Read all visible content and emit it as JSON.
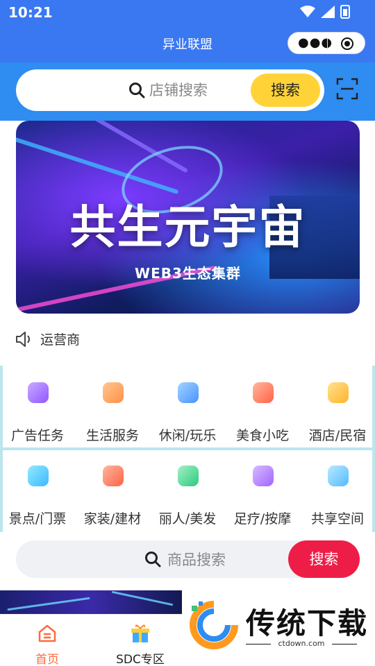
{
  "status_bar": {
    "time": "10:21"
  },
  "app": {
    "title": "异业联盟"
  },
  "store_search": {
    "placeholder": "店铺搜索",
    "button": "搜索"
  },
  "banner": {
    "title": "共生元宇宙",
    "subtitle": "WEB3生态集群"
  },
  "notice": {
    "text": "运营商"
  },
  "categories_row1": [
    {
      "label": "广告任务",
      "icon": "bell-icon"
    },
    {
      "label": "生活服务",
      "icon": "phone-charge-icon"
    },
    {
      "label": "休闲/玩乐",
      "icon": "gamepad-icon"
    },
    {
      "label": "美食小吃",
      "icon": "burger-icon"
    },
    {
      "label": "酒店/民宿",
      "icon": "hotel-icon"
    }
  ],
  "categories_row2": [
    {
      "label": "景点/门票",
      "icon": "ticket-icon"
    },
    {
      "label": "家装/建材",
      "icon": "sofa-icon"
    },
    {
      "label": "丽人/美发",
      "icon": "hair-icon"
    },
    {
      "label": "足疗/按摩",
      "icon": "foot-icon"
    },
    {
      "label": "共享空间",
      "icon": "cocktail-icon"
    }
  ],
  "product_search": {
    "placeholder": "商品搜索",
    "button": "搜索"
  },
  "tabs": [
    {
      "label": "首页",
      "icon": "home-icon",
      "active": true
    },
    {
      "label": "SDC专区",
      "icon": "gift-icon",
      "active": false
    }
  ],
  "watermark": {
    "title": "传统下载",
    "url": "ctdown.com"
  },
  "colors": {
    "primary_blue": "#3a78f2",
    "search_yellow": "#ffd338",
    "search_red": "#ee1d47",
    "active_tab": "#ff6a3d"
  }
}
